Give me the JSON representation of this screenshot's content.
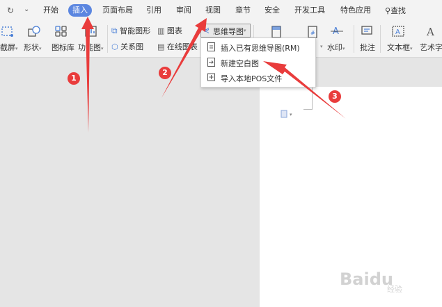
{
  "menubar": {
    "items": [
      "开始",
      "插入",
      "页面布局",
      "引用",
      "审阅",
      "视图",
      "章节",
      "安全",
      "开发工具",
      "特色应用"
    ],
    "active_index": 1,
    "search_label": "查找"
  },
  "toolbar": {
    "screenshot": "截屏",
    "shapes": "形状",
    "icon_library": "图标库",
    "function_chart": "功能图",
    "smart_shape": "智能图形",
    "chart": "图表",
    "relation_chart": "关系图",
    "online_chart": "在线图表",
    "mindmap": "思维导图",
    "watermark": "水印",
    "comment": "批注",
    "textbox": "文本框",
    "art_text": "艺术字"
  },
  "mindmap_menu": {
    "items": [
      "插入已有思维导图(RM)",
      "新建空白图",
      "导入本地POS文件"
    ]
  },
  "annotations": {
    "badges": [
      "1",
      "2",
      "3"
    ],
    "color": "#e93c3c"
  },
  "watermark": {
    "text": "Baidu",
    "sub": "经验"
  },
  "colors": {
    "active_tab": "#5b86e0",
    "toolbar_bg": "#f3f3f3",
    "canvas_bg": "#e5e5e5"
  }
}
